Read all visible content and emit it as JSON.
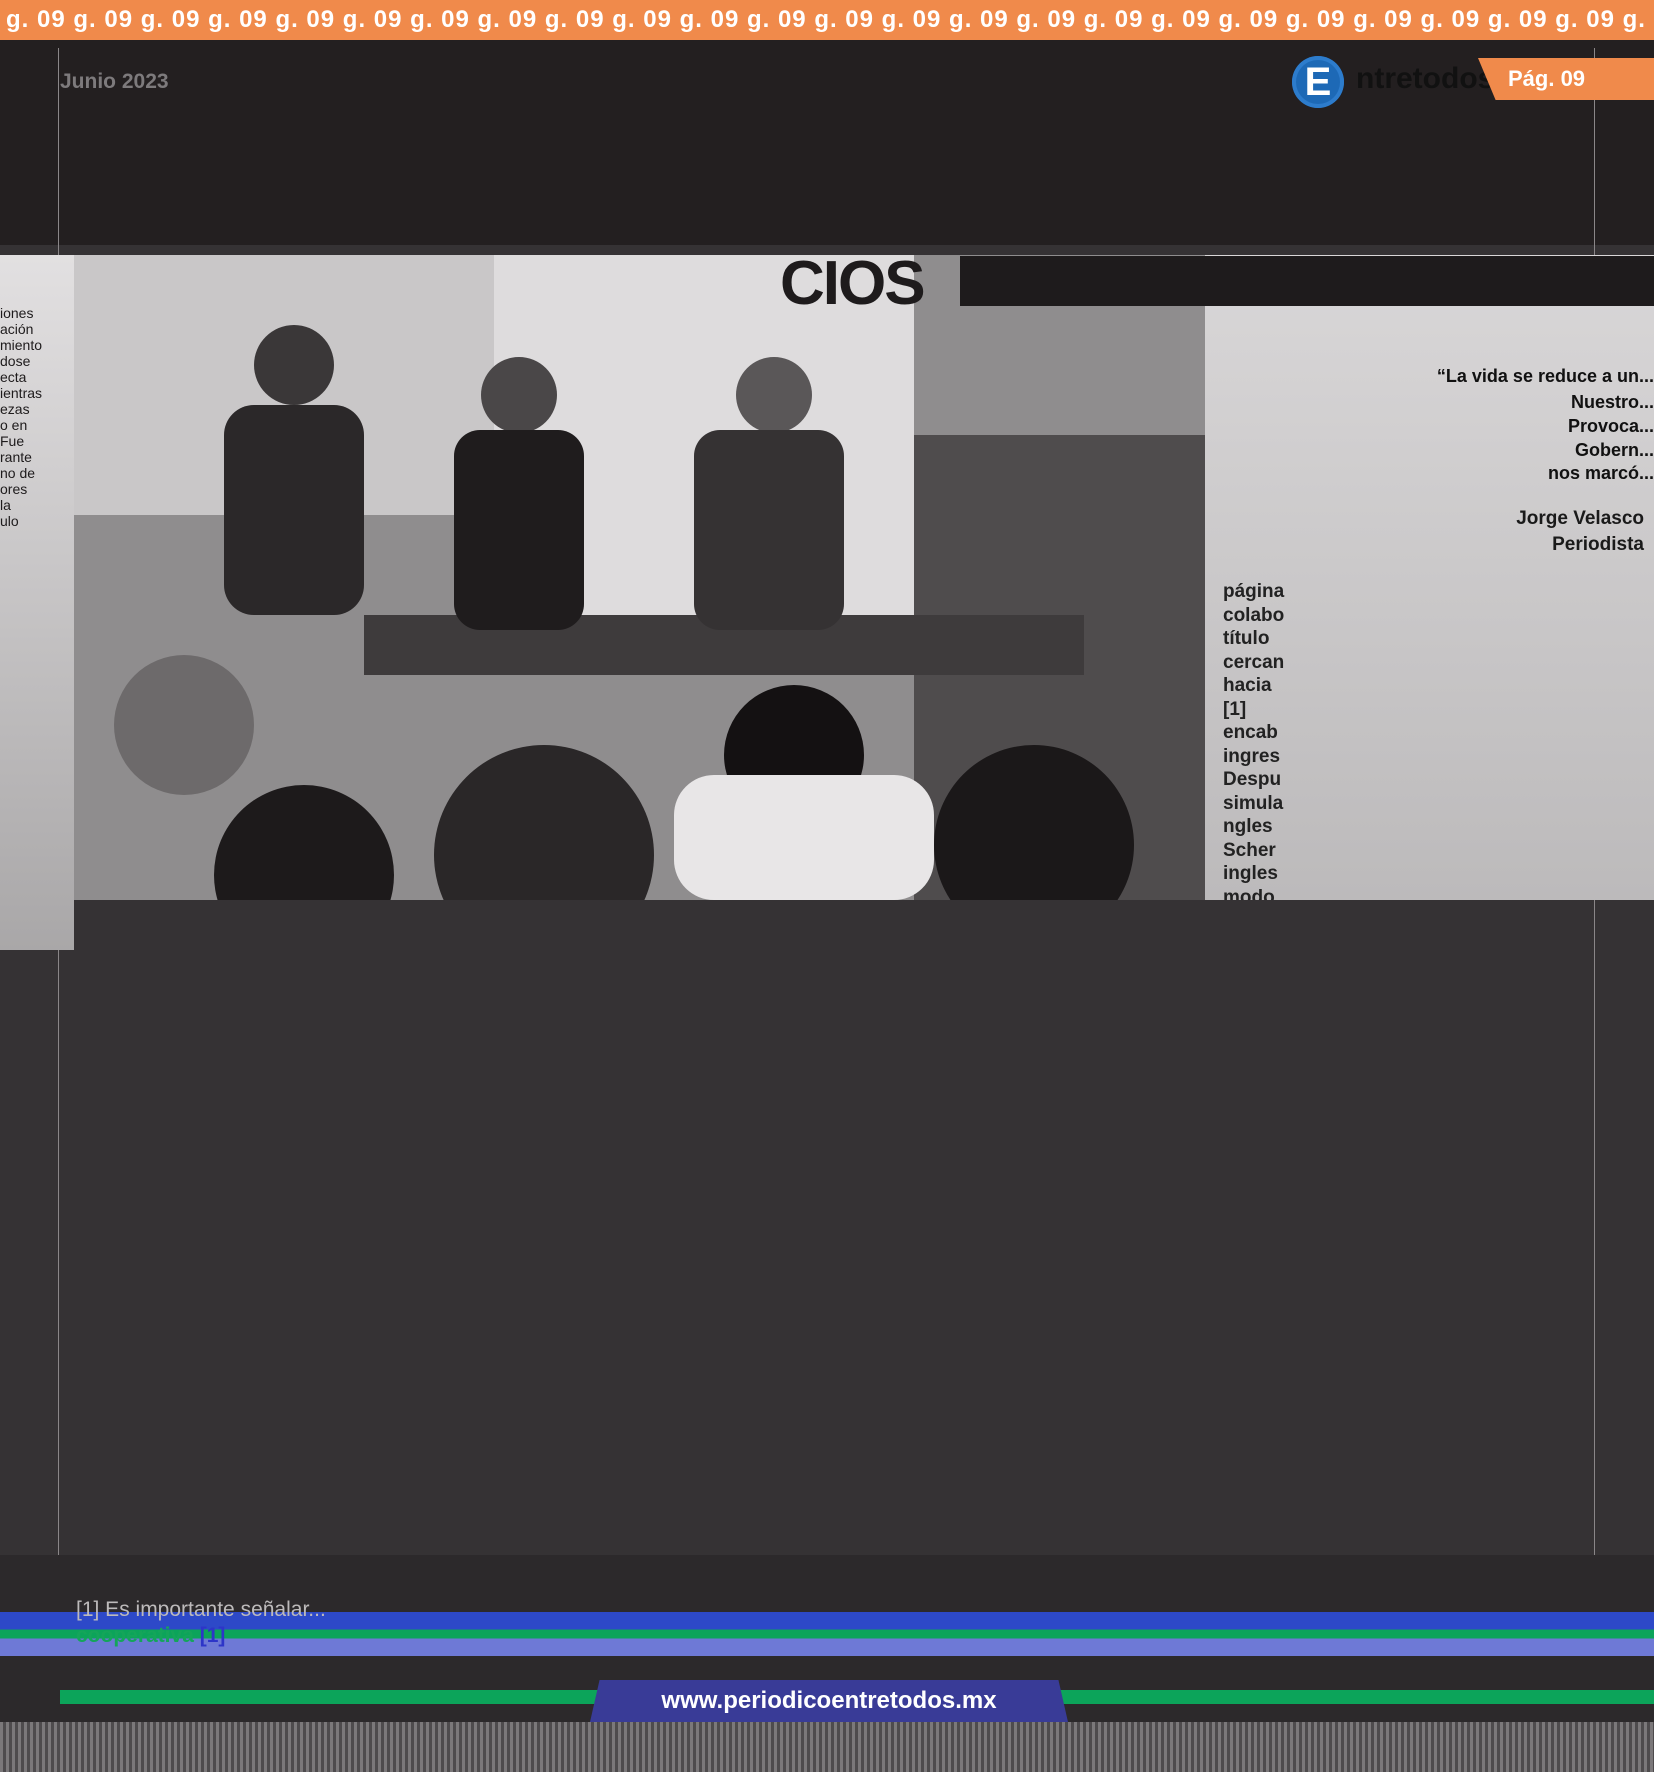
{
  "header": {
    "page_strip": "g. 09 g. 09 g. 09 g. 09 g. 09 g. 09 g. 09 g. 09 g. 09 g. 09 g. 09 g. 09 g. 09 g. 09 g. 09 g. 09 g. 09 g. 09 g. 09 g. 09 g. 09 g. 09 g. 09 g. 09 g. 09 g. 09 g. 09",
    "date": "Junio 2023",
    "logo_letter": "E",
    "logo_word": "ntretodos",
    "page_tag": "Pág. 09"
  },
  "article": {
    "headline": "CIOS",
    "quote_lines": [
      "“La vida se reduce a un...",
      "Nuestro...",
      "Provoca...",
      "Gobern...",
      "nos marcó..."
    ],
    "author": "Jorge Velasco",
    "author_role": "Periodista",
    "body_lines": [
      "página",
      "colabo",
      "título",
      "cercan",
      "hacia",
      "[1]",
      "encab",
      "ingres",
      "Despu",
      "simula",
      "ngles",
      "Scher",
      "ingles",
      "modo"
    ],
    "left_col_lines": [
      "iones",
      "ación",
      "miento",
      "dose",
      "ecta",
      "ientras",
      "ezas",
      "o en",
      "Fue",
      "rante",
      "no de",
      "ores",
      "la",
      "ulo"
    ]
  },
  "footnotes": {
    "line1": "[1] Es importante señalar...",
    "coop_word": "cooperativa",
    "ref_mark": "[1]"
  },
  "footer": {
    "url": "www.periodicoentretodos.mx"
  }
}
